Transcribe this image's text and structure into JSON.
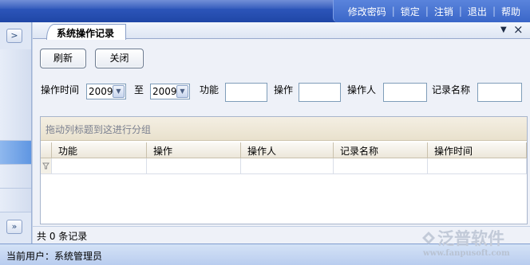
{
  "topmenu": {
    "items": [
      "修改密码",
      "锁定",
      "注销",
      "退出",
      "帮助"
    ]
  },
  "rail": {
    "top_button": ">",
    "bottom_button": "»"
  },
  "tab": {
    "title": "系统操作记录",
    "dropdown_icon": "▼",
    "close_icon": "×"
  },
  "toolbar": {
    "refresh_label": "刷新",
    "close_label": "关闭"
  },
  "filters": {
    "time_label": "操作时间",
    "from_value": "2009",
    "to_label": "至",
    "to_value": "2009",
    "function_label": "功能",
    "operation_label": "操作",
    "operator_label": "操作人",
    "record_name_label": "记录名称"
  },
  "grid": {
    "group_hint": "拖动列标题到这进行分组",
    "columns": [
      "功能",
      "操作",
      "操作人",
      "记录名称",
      "操作时间"
    ],
    "filter_row_icon": "filter-icon"
  },
  "footer": {
    "count_text": "共 0 条记录"
  },
  "status": {
    "user_text": "当前用户：系统管理员"
  },
  "logo": {
    "brand": "泛普软件",
    "url": "www.fanpusoft.com"
  },
  "colors": {
    "topbar": "#2b54b8",
    "accent": "#5f96e2",
    "statusbar": "#b9cdef"
  }
}
